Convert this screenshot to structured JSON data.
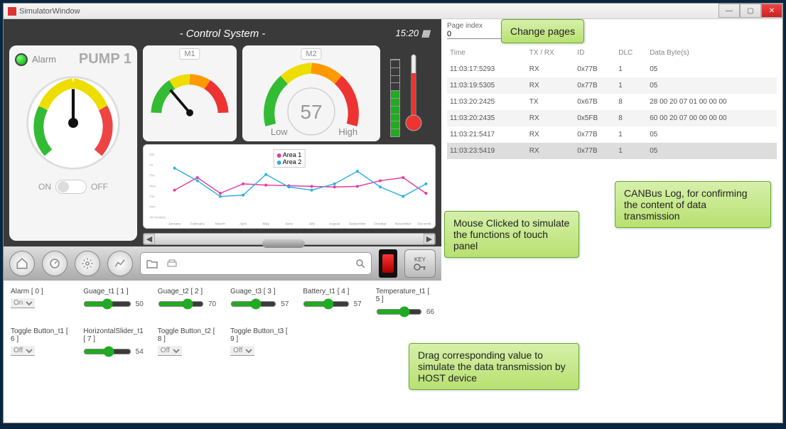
{
  "window": {
    "title": "SimulatorWindow"
  },
  "dashboard": {
    "title": "- Control System -",
    "time": "15:20",
    "pump": {
      "alarm": "Alarm",
      "label": "PUMP 1",
      "on": "ON",
      "off": "OFF"
    },
    "m1": "M1",
    "m2": "M2",
    "m2value": "57",
    "low": "Low",
    "high": "High",
    "key": "KEY"
  },
  "chart_data": {
    "type": "line",
    "categories": [
      "January",
      "February",
      "March",
      "April",
      "May",
      "June",
      "July",
      "August",
      "September",
      "October",
      "November",
      "December"
    ],
    "series": [
      {
        "name": "Area 1",
        "color": "#e63aa0",
        "values": [
          40,
          60,
          35,
          50,
          48,
          47,
          46,
          45,
          46,
          55,
          60,
          35
        ]
      },
      {
        "name": "Area 2",
        "color": "#2ab0e6",
        "values": [
          75,
          55,
          30,
          32,
          65,
          45,
          40,
          50,
          70,
          45,
          30,
          50
        ]
      }
    ],
    "ylim": [
      0,
      100
    ],
    "ylabels": [
      "Sat",
      "Fri",
      "Tho",
      "Wen",
      "Tue",
      "Mon",
      "All monitors"
    ]
  },
  "page": {
    "label": "Page index",
    "value": "0"
  },
  "log": {
    "headers": [
      "Time",
      "TX / RX",
      "ID",
      "DLC",
      "Data Byte(s)"
    ],
    "rows": [
      [
        "11:03:17:5293",
        "RX",
        "0x77B",
        "1",
        "05"
      ],
      [
        "11:03:19:5305",
        "RX",
        "0x77B",
        "1",
        "05"
      ],
      [
        "11:03:20:2425",
        "TX",
        "0x67B",
        "8",
        "28 00 20 07 01 00 00 00"
      ],
      [
        "11:03:20:2435",
        "RX",
        "0x5FB",
        "8",
        "60 00 20 07 00 00 00 00"
      ],
      [
        "11:03:21:5417",
        "RX",
        "0x77B",
        "1",
        "05"
      ],
      [
        "11:03:23:5419",
        "RX",
        "0x77B",
        "1",
        "05"
      ]
    ]
  },
  "sliders": [
    {
      "label": "Alarm  [ 0 ]",
      "type": "select",
      "value": "On"
    },
    {
      "label": "Guage_t1  [ 1 ]",
      "type": "range",
      "value": "50"
    },
    {
      "label": "Guage_t2  [ 2 ]",
      "type": "range",
      "value": "70"
    },
    {
      "label": "Guage_t3  [ 3 ]",
      "type": "range",
      "value": "57"
    },
    {
      "label": "Battery_t1  [ 4 ]",
      "type": "range",
      "value": "57"
    },
    {
      "label": "Temperature_t1  [ 5 ]",
      "type": "range",
      "value": "66"
    },
    {
      "label": "Toggle Button_t1  [ 6 ]",
      "type": "select",
      "value": "Off"
    },
    {
      "label": "HorizontalSlider_t1  [ 7 ]",
      "type": "range",
      "value": "54"
    },
    {
      "label": "Toggle Button_t2  [ 8 ]",
      "type": "select",
      "value": "Off"
    },
    {
      "label": "Toggle Button_t3  [ 9 ]",
      "type": "select",
      "value": "Off"
    }
  ],
  "callouts": {
    "pages": "Change pages",
    "mouse": "Mouse Clicked to simulate the functions of touch panel",
    "canbus": "CANBus Log,  for confirming the content of data transmission",
    "drag": "Drag corresponding value to simulate the data transmission by HOST device"
  }
}
